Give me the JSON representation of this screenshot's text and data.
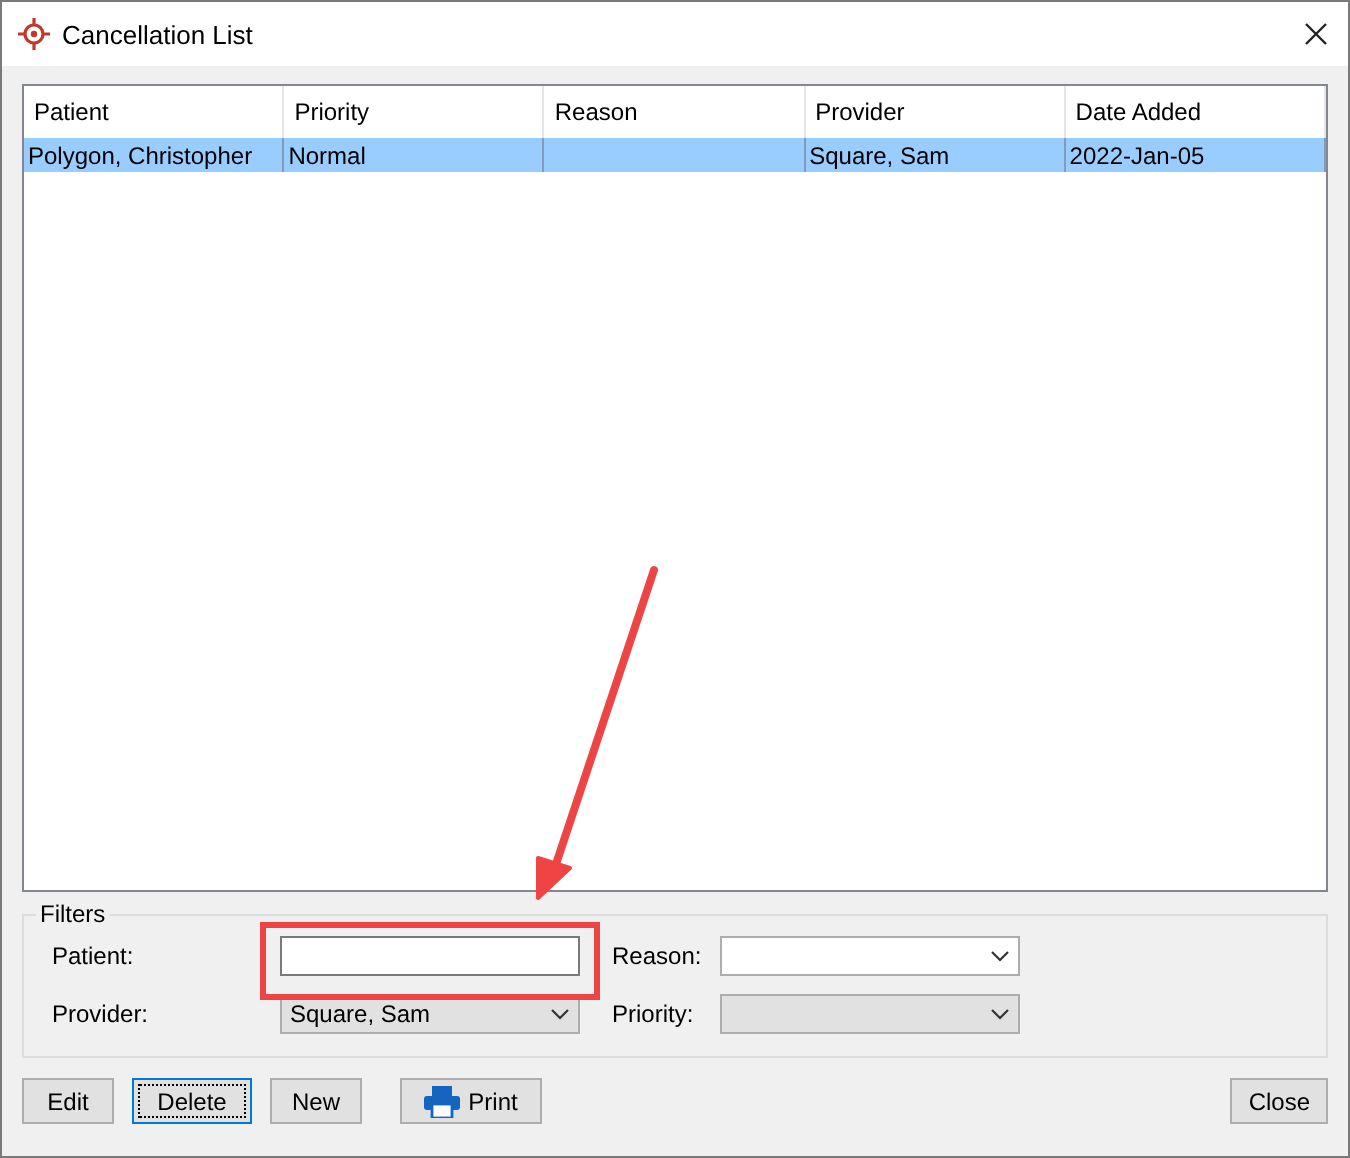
{
  "window": {
    "title": "Cancellation List"
  },
  "table": {
    "columns": [
      "Patient",
      "Priority",
      "Reason",
      "Provider",
      "Date Added"
    ],
    "rows": [
      {
        "cells": [
          "Polygon, Christopher",
          "Normal",
          "",
          "Square, Sam",
          "2022-Jan-05"
        ],
        "selected": true
      }
    ]
  },
  "filters": {
    "title": "Filters",
    "fields": [
      {
        "label": "Patient:",
        "kind": "text",
        "disabled": false
      },
      {
        "label": "Reason:",
        "kind": "combo",
        "disabled": false
      },
      {
        "label": "Provider:",
        "kind": "combo",
        "value": "Square, Sam",
        "disabled": true
      },
      {
        "label": "Priority:",
        "kind": "combo",
        "disabled": true
      }
    ]
  },
  "buttons": [
    {
      "label": "Edit",
      "focused": false,
      "kind": "plain"
    },
    {
      "label": "Delete",
      "focused": true,
      "kind": "plain"
    },
    {
      "label": "New",
      "focused": false,
      "kind": "plain"
    },
    {
      "label": "Print",
      "focused": false,
      "kind": "printer"
    }
  ],
  "close_button": {
    "label": "Close",
    "focused": false
  },
  "annotation": {
    "highlight_box": true,
    "arrow": true
  }
}
